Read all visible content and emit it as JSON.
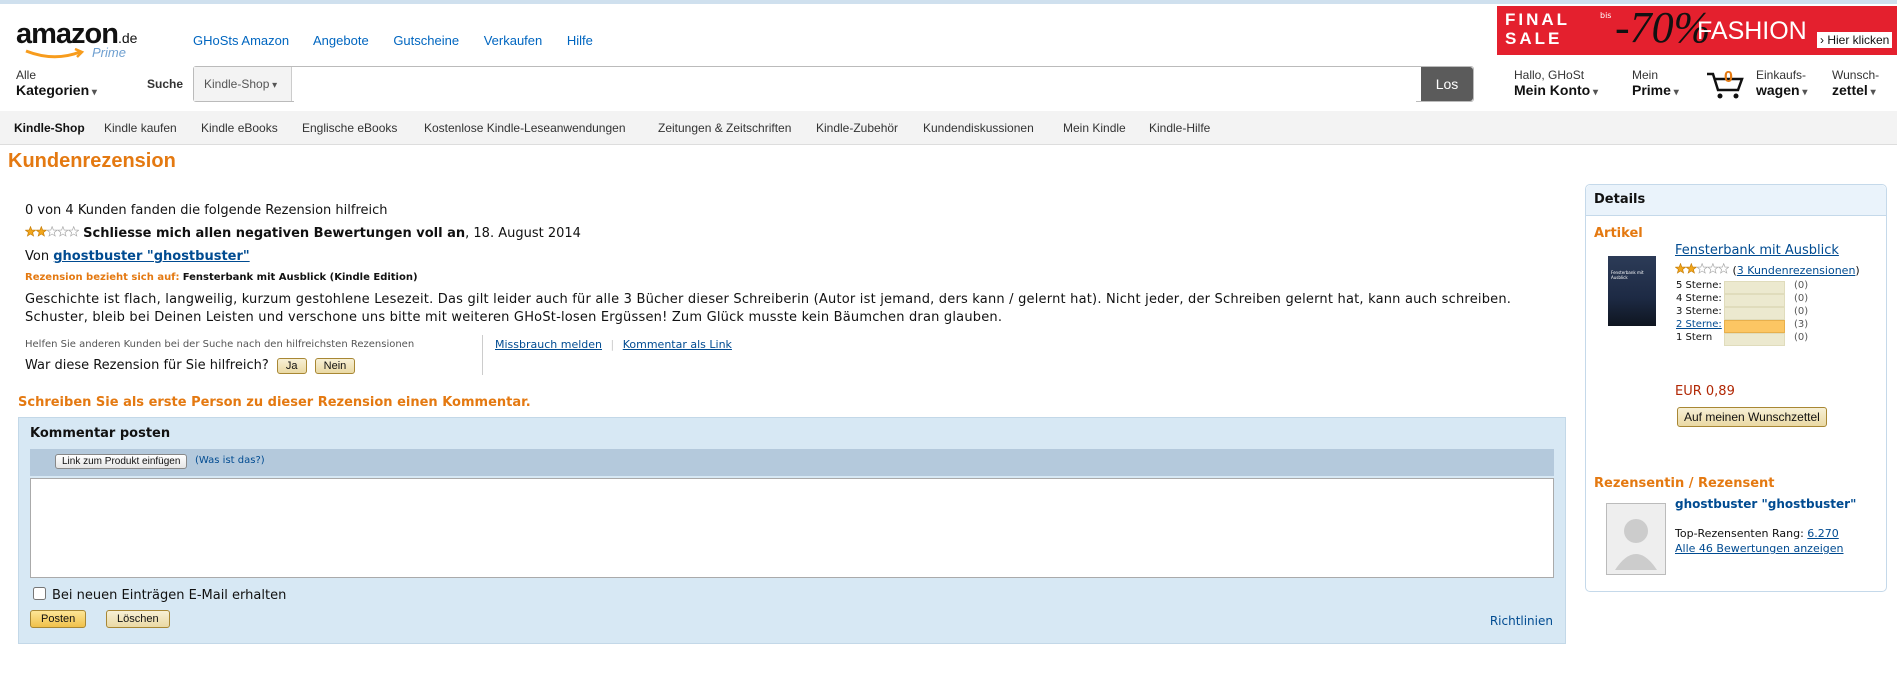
{
  "header": {
    "logo": {
      "brand": "amazon",
      "tld": ".de",
      "sub": "Prime"
    },
    "top_links": [
      "GHoSts Amazon",
      "Angebote",
      "Gutscheine",
      "Verkaufen",
      "Hilfe"
    ],
    "banner": {
      "line1": "FINAL",
      "line2": "SALE",
      "bis": "bis",
      "percent": "-70%",
      "word": "FASHION",
      "cta": "› Hier klicken"
    },
    "categories": {
      "small": "Alle",
      "big": "Kategorien"
    },
    "search": {
      "label": "Suche",
      "scope": "Kindle-Shop",
      "value": "",
      "button": "Los"
    },
    "account": {
      "small": "Hallo, GHoSt",
      "big": "Mein Konto"
    },
    "prime": {
      "small": "Mein",
      "big": "Prime"
    },
    "cart": {
      "count": "0",
      "small": "Einkaufs-",
      "big": "wagen"
    },
    "wishlist": {
      "small": "Wunsch-",
      "big": "zettel"
    }
  },
  "subnav": [
    "Kindle-Shop",
    "Kindle kaufen",
    "Kindle eBooks",
    "Englische eBooks",
    "Kostenlose Kindle-Leseanwendungen",
    "Zeitungen & Zeitschriften",
    "Kindle-Zubehör",
    "Kundendiskussionen",
    "Mein Kindle",
    "Kindle-Hilfe"
  ],
  "page_title": "Kundenrezension",
  "review": {
    "helpful_count": "0 von 4 Kunden fanden die folgende Rezension hilfreich",
    "rating": 2,
    "title": "Schliesse mich allen negativen Bewertungen voll an",
    "date": ", 18. August 2014",
    "by_label": "Von",
    "author": "ghostbuster \"ghostbuster\"",
    "refers_label": "Rezension bezieht sich auf:",
    "refers_value": "Fensterbank mit Ausblick (Kindle Edition)",
    "body": "Geschichte ist flach, langweilig, kurzum gestohlene Lesezeit. Das gilt leider auch für alle 3 Bücher dieser Schreiberin (Autor ist jemand, ders kann / gelernt hat). Nicht jeder, der Schreiben gelernt hat, kann auch schreiben. Schuster, bleib bei Deinen Leisten und verschone uns bitte mit weiteren GHoSt-losen Ergüssen! Zum Glück musste kein Bäumchen dran glauben.",
    "help_others": "Helfen Sie anderen Kunden bei der Suche nach den hilfreichsten Rezensionen",
    "was_helpful": "War diese Rezension für Sie hilfreich?",
    "yes": "Ja",
    "no": "Nein",
    "report": "Missbrauch melden",
    "link_comment": "Kommentar als Link"
  },
  "comment": {
    "prompt": "Schreiben Sie als erste Person zu dieser Rezension einen Kommentar.",
    "box_title": "Kommentar posten",
    "insert_link": "Link zum Produkt einfügen",
    "what_is": "(Was ist das?)",
    "textarea_value": "",
    "email_checkbox": "Bei neuen Einträgen E-Mail erhalten",
    "post": "Posten",
    "delete": "Löschen",
    "guidelines": "Richtlinien"
  },
  "sidebar": {
    "title": "Details",
    "article_label": "Artikel",
    "product_title": "Fensterbank mit Ausblick",
    "cover_text": "Fensterbank mit Ausblick",
    "product_rating": 2,
    "review_count_link": "3 Kundenrezensionen",
    "histogram": [
      {
        "label": "5 Sterne:",
        "count": "(0)",
        "fraction": 0,
        "linked": false
      },
      {
        "label": "4 Sterne:",
        "count": "(0)",
        "fraction": 0,
        "linked": false
      },
      {
        "label": "3 Sterne:",
        "count": "(0)",
        "fraction": 0,
        "linked": false
      },
      {
        "label": "2 Sterne",
        "count": "(3)",
        "fraction": 1,
        "linked": true
      },
      {
        "label": "1 Stern",
        "count": "(0)",
        "fraction": 0,
        "linked": false
      }
    ],
    "price": "EUR 0,89",
    "wishlist_button": "Auf meinen Wunschzettel",
    "reviewer_label": "Rezensentin / Rezensent",
    "reviewer_name": "ghostbuster \"ghostbuster\"",
    "rank_label": "Top-Rezensenten Rang:",
    "rank_value": "6.270",
    "all_reviews": "Alle 46 Bewertungen anzeigen"
  },
  "colors": {
    "accent": "#e47911",
    "link": "#004b91",
    "banner": "#e4202e"
  }
}
